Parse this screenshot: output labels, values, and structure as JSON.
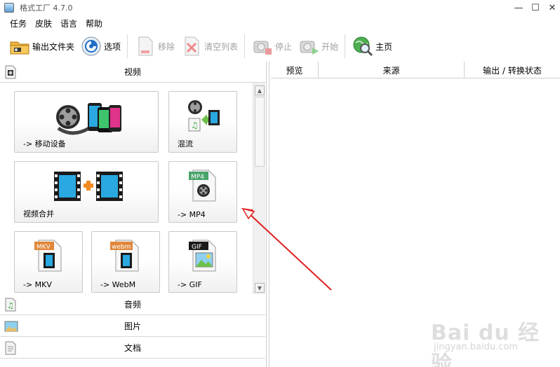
{
  "window": {
    "title": "格式工厂 4.7.0",
    "minimize": "—",
    "maximize": "☐",
    "close": "✕"
  },
  "menu": [
    "任务",
    "皮肤",
    "语言",
    "帮助"
  ],
  "toolbar": {
    "output_folder": "输出文件夹",
    "options": "选项",
    "remove": "移除",
    "clear_list": "清空列表",
    "stop": "停止",
    "start": "开始",
    "home": "主页"
  },
  "categories": {
    "video": "视频",
    "audio": "音频",
    "image": "图片",
    "document": "文档"
  },
  "tiles": [
    {
      "label": "-> 移动设备",
      "icon": "mobile-device-icon"
    },
    {
      "label": "混流",
      "icon": "mux-icon"
    },
    {
      "label": "视频合并",
      "icon": "video-join-icon"
    },
    {
      "label": "-> MP4",
      "icon": "mp4-file-icon",
      "badge": "MP4"
    },
    {
      "label": "-> MKV",
      "icon": "mkv-file-icon",
      "badge": "MKV"
    },
    {
      "label": "-> WebM",
      "icon": "webm-file-icon",
      "badge": "webm"
    },
    {
      "label": "-> GIF",
      "icon": "gif-file-icon",
      "badge": "GIF"
    }
  ],
  "grid": {
    "columns": [
      "预览",
      "来源",
      "输出 / 转换状态"
    ]
  },
  "watermark": {
    "brand": "Bai du 经验",
    "url": "jingyan.baidu.com"
  },
  "colors": {
    "accent_orange": "#f28a1e",
    "film_blue": "#2aa8e0",
    "annotation_red": "#e02020"
  }
}
